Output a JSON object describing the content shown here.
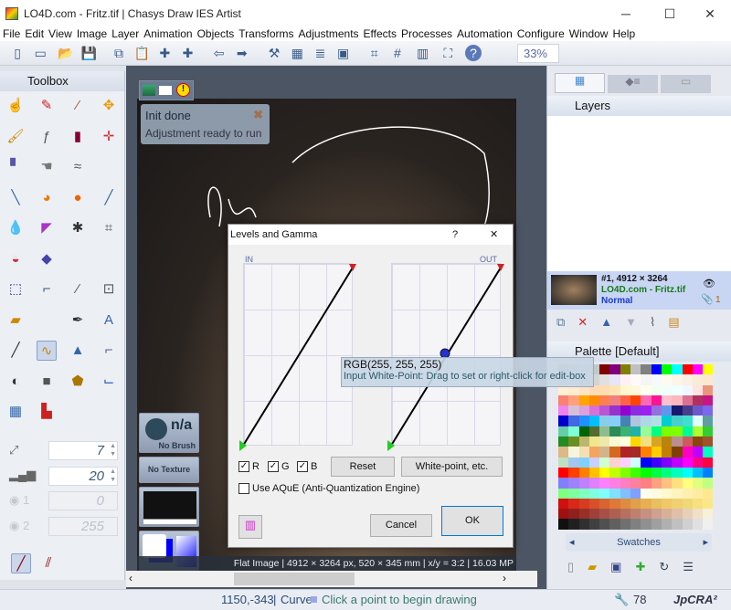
{
  "window": {
    "title": "LO4D.com - Fritz.tif | Chasys Draw IES Artist",
    "minimize": "─",
    "maximize": "☐",
    "close": "✕"
  },
  "menu": [
    "File",
    "Edit",
    "View",
    "Image",
    "Layer",
    "Animation",
    "Objects",
    "Transforms",
    "Adjustments",
    "Effects",
    "Processes",
    "Automation",
    "Configure",
    "Window",
    "Help"
  ],
  "toolbar": {
    "icons": [
      "new-file-icon",
      "new-window-icon",
      "open-icon",
      "save-icon",
      "copy-icon",
      "paste-icon",
      "paste-new-icon",
      "paste-layer-icon",
      "undo-icon",
      "redo-icon",
      "hammer-icon",
      "palette-icon",
      "layers-icon",
      "image-icon",
      "crop-grid-icon",
      "grid-icon",
      "panel-icon",
      "fullscreen-icon",
      "help-icon"
    ],
    "zoom": "33%"
  },
  "toolbox": {
    "title": "Toolbox",
    "brush_size": "7",
    "opacity": "20",
    "threshold1": "0",
    "threshold2": "255",
    "label1": "1",
    "label2": "2"
  },
  "canvas_side": {
    "brush_label": "n/a",
    "brush_sub": "No Brush",
    "texture": "No Texture"
  },
  "notification": {
    "title": "Init done",
    "message": "Adjustment ready to run"
  },
  "image_status": "Flat Image | 4912 × 3264 px, 520 × 345 mm | x/y = 3:2 | 16.03 MP",
  "dialog": {
    "title": "Levels and Gamma",
    "help": "?",
    "close": "✕",
    "in_label": "IN",
    "out_label": "OUT",
    "r": "R",
    "g": "G",
    "b": "B",
    "reset": "Reset",
    "whitepoint": "White-point, etc.",
    "aque": "Use AQuE (Anti-Quantization Engine)",
    "cancel": "Cancel",
    "ok": "OK",
    "r_checked": true,
    "g_checked": true,
    "b_checked": true,
    "aque_checked": false
  },
  "tooltip": {
    "value": "RGB(255, 255, 255)",
    "hint": "Input White-Point: Drag to set or right-click for edit-box"
  },
  "layers": {
    "title": "Layers",
    "item": {
      "name": "#1, 4912 × 3264",
      "file": "LO4D.com - Fritz.tif",
      "mode": "Normal",
      "attachments": "1"
    }
  },
  "palette": {
    "title": "Palette [Default]",
    "swatches_label": "Swatches",
    "colors": [
      "#a6b0c0",
      "#b0b8c8",
      "#b8c4c4",
      "#c0c8c8",
      "#800000",
      "#800080",
      "#808000",
      "#c0c0c0",
      "#808080",
      "#0000ff",
      "#00ff00",
      "#00ffff",
      "#ff0000",
      "#ff00ff",
      "#ffff00",
      "#c8c8d8",
      "#d8d8e0",
      "#c0c0c0",
      "#d4d4d4",
      "#e0e0e0",
      "#e6e6fa",
      "#fff0f5",
      "#fffafa",
      "#f5f5f5",
      "#f8f8ff",
      "#fffaf0",
      "#fdf5e6",
      "#faf0e6",
      "#faebd7",
      "#fae8d0",
      "#ffefd5",
      "#ffebcd",
      "#ffe4c4",
      "#ffdab9",
      "#ffdead",
      "#ffe4b5",
      "#fffacd",
      "#fff8dc",
      "#fffff0",
      "#f0fff0",
      "#f0fffa",
      "#f0ffff",
      "#f0f8ff",
      "#ffe4e1",
      "#e9967a",
      "#fa8072",
      "#ffa07a",
      "#ffa500",
      "#ff8c00",
      "#ff7f50",
      "#f08080",
      "#ff6347",
      "#ff4500",
      "#ff69b4",
      "#ff1493",
      "#ffc0cb",
      "#ffb6c1",
      "#db7093",
      "#b03060",
      "#c71585",
      "#ee82ee",
      "#d8bfd8",
      "#dda0dd",
      "#da70d6",
      "#ba55d3",
      "#9932cc",
      "#9400d3",
      "#8a2be2",
      "#a020f0",
      "#9370db",
      "#6495ed",
      "#191970",
      "#483d8b",
      "#6a5acd",
      "#7b68ee",
      "#0000cd",
      "#4169e1",
      "#1e90ff",
      "#00bfff",
      "#87ceeb",
      "#87cefa",
      "#4682b4",
      "#b0c4de",
      "#add8e6",
      "#b0e0e6",
      "#00ced1",
      "#48d1cc",
      "#40e0d0",
      "#e0ffff",
      "#5f9ea0",
      "#66cdaa",
      "#7fffd4",
      "#006400",
      "#556b2f",
      "#8fbc8f",
      "#2e8b57",
      "#3cb371",
      "#20b2aa",
      "#98fb98",
      "#00ff7f",
      "#7cfc00",
      "#7fff00",
      "#00fa9a",
      "#adff2f",
      "#32cd32",
      "#228b22",
      "#6b8e23",
      "#bdb76b",
      "#f0e68c",
      "#eee8aa",
      "#fafad2",
      "#ffffe0",
      "#ffd700",
      "#f0e080",
      "#daa520",
      "#b8860b",
      "#bc8f8f",
      "#cd5c5c",
      "#8b4513",
      "#a0522d",
      "#deb887",
      "#f5f5dc",
      "#f5deb3",
      "#f4a460",
      "#d2b48c",
      "#d2691e",
      "#b22222",
      "#a52a2a",
      "#ff8000",
      "#ffcc00",
      "#c08000",
      "#804000",
      "#ff00c0",
      "#c000ff",
      "#00ffc0",
      "#c0e0c0",
      "#a0c8f0",
      "#80d0ff",
      "#c8d0ff",
      "#d0ffd0",
      "#ffd0d0",
      "#ffd0ff",
      "#d0ffff",
      "#0000ff",
      "#4000ff",
      "#8000ff",
      "#c000ff",
      "#ff00ff",
      "#ff0080",
      "#ff0040",
      "#ff0000",
      "#ff4000",
      "#ff8000",
      "#ffc000",
      "#ffff00",
      "#c0ff00",
      "#80ff00",
      "#40ff00",
      "#00ff00",
      "#00ff40",
      "#00ff80",
      "#00ffc0",
      "#00ffff",
      "#00c0ff",
      "#0080ff",
      "#8080ff",
      "#a080ff",
      "#c080ff",
      "#e080ff",
      "#ff80ff",
      "#ff80e0",
      "#ff80c0",
      "#ff80a0",
      "#ff8080",
      "#ffa080",
      "#ffc080",
      "#ffe080",
      "#ffff80",
      "#e0ff80",
      "#c0ff80",
      "#80ff80",
      "#80ffa0",
      "#80ffc0",
      "#80ffe0",
      "#80ffff",
      "#80e0ff",
      "#80c0ff",
      "#80a0ff",
      "#fffff0",
      "#fffbe0",
      "#fff8d0",
      "#fff4c0",
      "#fff0b0",
      "#ffecA0",
      "#ffe890",
      "#d01010",
      "#d82818",
      "#d83c20",
      "#d85028",
      "#d86430",
      "#e07838",
      "#e08c40",
      "#e0a048",
      "#e8b050",
      "#e8c060",
      "#f0c868",
      "#f0d070",
      "#f0d878",
      "#f8e080",
      "#f8e888",
      "#a01010",
      "#902020",
      "#983028",
      "#a04038",
      "#a85048",
      "#b06050",
      "#b87060",
      "#c08070",
      "#c89080",
      "#d0a090",
      "#d8b098",
      "#e0c0a8",
      "#e8d0b8",
      "#f0e0c8",
      "#f8f0d8",
      "#101010",
      "#202020",
      "#303030",
      "#404040",
      "#505050",
      "#606060",
      "#707070",
      "#808080",
      "#909090",
      "#a0a0a0",
      "#b0b0b0",
      "#c0c0c0",
      "#d0d0d0",
      "#e0e0e0",
      "#f0f0f0"
    ]
  },
  "statusbar": {
    "coords": "1150,-343",
    "tool": "Curve",
    "hint": "Click a point to begin drawing",
    "counter": "78",
    "brand_text": "JpCRA²"
  },
  "tools": [
    "pointer-icon",
    "pencil-icon",
    "eyedropper-icon",
    "move-icon",
    "brush-icon",
    "fx-brush-icon",
    "marker-icon",
    "clone-icon",
    "spray-icon",
    "smudge-icon",
    "wave-icon",
    "blank",
    "airbrush-icon",
    "paint-icon",
    "sphere-icon",
    "pen-icon",
    "drop-icon",
    "cone-icon",
    "splat-icon",
    "hash-icon",
    "bucket-icon",
    "gradient-fill-icon",
    "blank",
    "blank",
    "select-icon",
    "crop-icon",
    "picker-icon",
    "zoom-icon",
    "ruler-icon",
    "blank",
    "feather-icon",
    "text-icon",
    "line-icon",
    "curve-icon",
    "shapes-icon",
    "corner-icon",
    "shade-icon",
    "cube-icon",
    "polygon-icon",
    "warp-icon",
    "color-swatch-icon",
    "histogram-icon",
    "blank",
    "blank"
  ]
}
